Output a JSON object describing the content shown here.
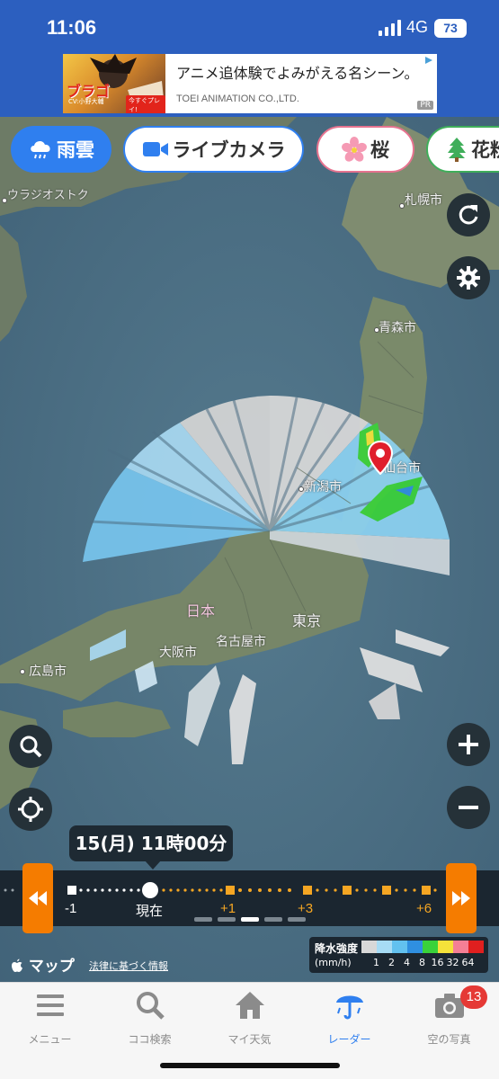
{
  "status": {
    "time": "11:06",
    "network": "4G",
    "battery": "73"
  },
  "ad": {
    "headline": "アニメ追体験でよみがえる名シーン。",
    "sponsor": "TOEI ANIMATION CO.,LTD.",
    "badge": "PR",
    "thumb_title": "ブラゴ",
    "thumb_caption": "CV:小野大輔",
    "thumb_play": "今すぐプレイ!"
  },
  "chips": [
    {
      "label": "雨雲",
      "icon": "rain-cloud-icon",
      "active": true
    },
    {
      "label": "ライブカメラ",
      "icon": "video-camera-icon",
      "active": false
    },
    {
      "label": "桜",
      "icon": "sakura-icon",
      "active": false
    },
    {
      "label": "花粉",
      "icon": "tree-icon",
      "active": false
    }
  ],
  "map": {
    "labels": {
      "vladivostok": "ウラジオストク",
      "sapporo": "札幌市",
      "aomori": "青森市",
      "sendai": "仙台市",
      "niigata": "新潟市",
      "japan": "日本",
      "tokyo": "東京",
      "nagoya": "名古屋市",
      "osaka": "大阪市",
      "hiroshima": "広島市"
    },
    "attribution": "マップ",
    "legal_link": "法律に基づく情報"
  },
  "timeline": {
    "current_time": "15(月) 11時00分",
    "labels": {
      "minus1": "-1",
      "now": "現在",
      "plus1": "+1",
      "plus3": "+3",
      "plus6": "+6"
    },
    "pages": 5,
    "active_page": 3
  },
  "legend": {
    "title": "降水強度",
    "unit": "(mm/h)",
    "values": [
      "1",
      "2",
      "4",
      "8",
      "16",
      "32",
      "64"
    ],
    "colors": [
      "#d8d8d8",
      "#a7dcf5",
      "#62c1ef",
      "#2f8fe0",
      "#3ad23a",
      "#f5e23a",
      "#f47f95",
      "#e01f1f"
    ]
  },
  "tabs": [
    {
      "label": "メニュー",
      "icon": "menu-icon",
      "active": false
    },
    {
      "label": "ココ検索",
      "icon": "search-icon",
      "active": false
    },
    {
      "label": "マイ天気",
      "icon": "home-icon",
      "active": false
    },
    {
      "label": "レーダー",
      "icon": "umbrella-radar-icon",
      "active": true
    },
    {
      "label": "空の写真",
      "icon": "camera-icon",
      "active": false
    }
  ],
  "photo_badge": "13"
}
